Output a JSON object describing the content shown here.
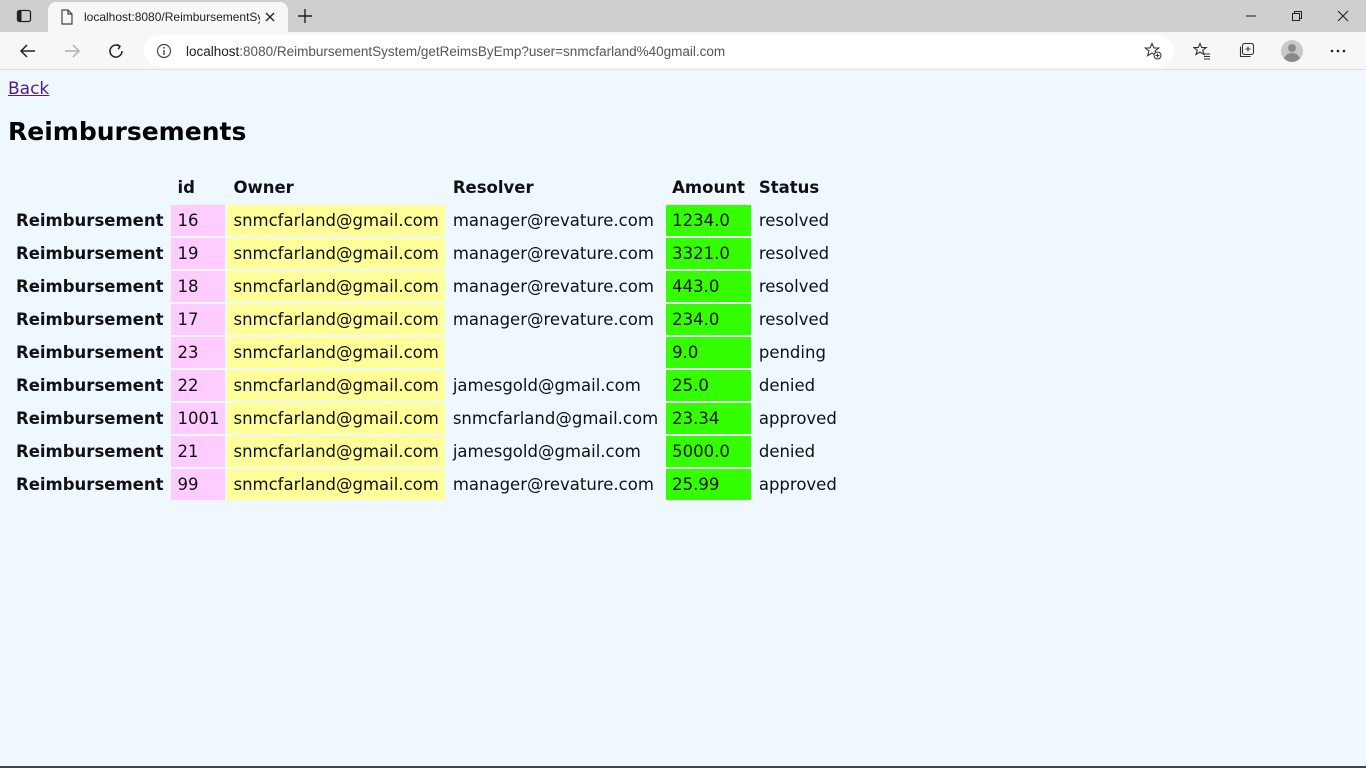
{
  "browser": {
    "tab_title": "localhost:8080/ReimbursementSy",
    "url_host": "localhost",
    "url_rest": ":8080/ReimbursementSystem/getReimsByEmp?user=snmcfarland%40gmail.com"
  },
  "page": {
    "back_label": "Back",
    "title": "Reimbursements"
  },
  "table": {
    "headers": {
      "label": "",
      "id": "id",
      "owner": "Owner",
      "resolver": "Resolver",
      "amount": "Amount",
      "status": "Status"
    },
    "rows": [
      {
        "label": "Reimbursement",
        "id": "16",
        "owner": "snmcfarland@gmail.com",
        "resolver": "manager@revature.com",
        "amount": "1234.0",
        "status": "resolved"
      },
      {
        "label": "Reimbursement",
        "id": "19",
        "owner": "snmcfarland@gmail.com",
        "resolver": "manager@revature.com",
        "amount": "3321.0",
        "status": "resolved"
      },
      {
        "label": "Reimbursement",
        "id": "18",
        "owner": "snmcfarland@gmail.com",
        "resolver": "manager@revature.com",
        "amount": "443.0",
        "status": "resolved"
      },
      {
        "label": "Reimbursement",
        "id": "17",
        "owner": "snmcfarland@gmail.com",
        "resolver": "manager@revature.com",
        "amount": "234.0",
        "status": "resolved"
      },
      {
        "label": "Reimbursement",
        "id": "23",
        "owner": "snmcfarland@gmail.com",
        "resolver": "",
        "amount": "9.0",
        "status": "pending"
      },
      {
        "label": "Reimbursement",
        "id": "22",
        "owner": "snmcfarland@gmail.com",
        "resolver": "jamesgold@gmail.com",
        "amount": "25.0",
        "status": "denied"
      },
      {
        "label": "Reimbursement",
        "id": "1001",
        "owner": "snmcfarland@gmail.com",
        "resolver": "snmcfarland@gmail.com",
        "amount": "23.34",
        "status": "approved"
      },
      {
        "label": "Reimbursement",
        "id": "21",
        "owner": "snmcfarland@gmail.com",
        "resolver": "jamesgold@gmail.com",
        "amount": "5000.0",
        "status": "denied"
      },
      {
        "label": "Reimbursement",
        "id": "99",
        "owner": "snmcfarland@gmail.com",
        "resolver": "manager@revature.com",
        "amount": "25.99",
        "status": "approved"
      }
    ]
  },
  "colors": {
    "id_cell": "#ffccff",
    "owner_cell": "#ffff99",
    "amount_cell": "#33ff00",
    "page_bg": "#eff7ff",
    "visited_link": "#551a8b"
  },
  "icons": {
    "tab_actions": "tab-actions-icon",
    "page": "page-icon",
    "close": "close-icon",
    "new_tab": "plus-icon",
    "minimize": "minimize-icon",
    "restore": "restore-icon",
    "window_close": "window-close-icon",
    "back": "arrow-left-icon",
    "forward": "arrow-right-icon",
    "refresh": "refresh-icon",
    "site_info": "info-icon",
    "add_favorite": "star-plus-icon",
    "favorites": "favorites-icon",
    "collections": "collections-icon",
    "profile": "avatar",
    "menu": "more-icon"
  }
}
